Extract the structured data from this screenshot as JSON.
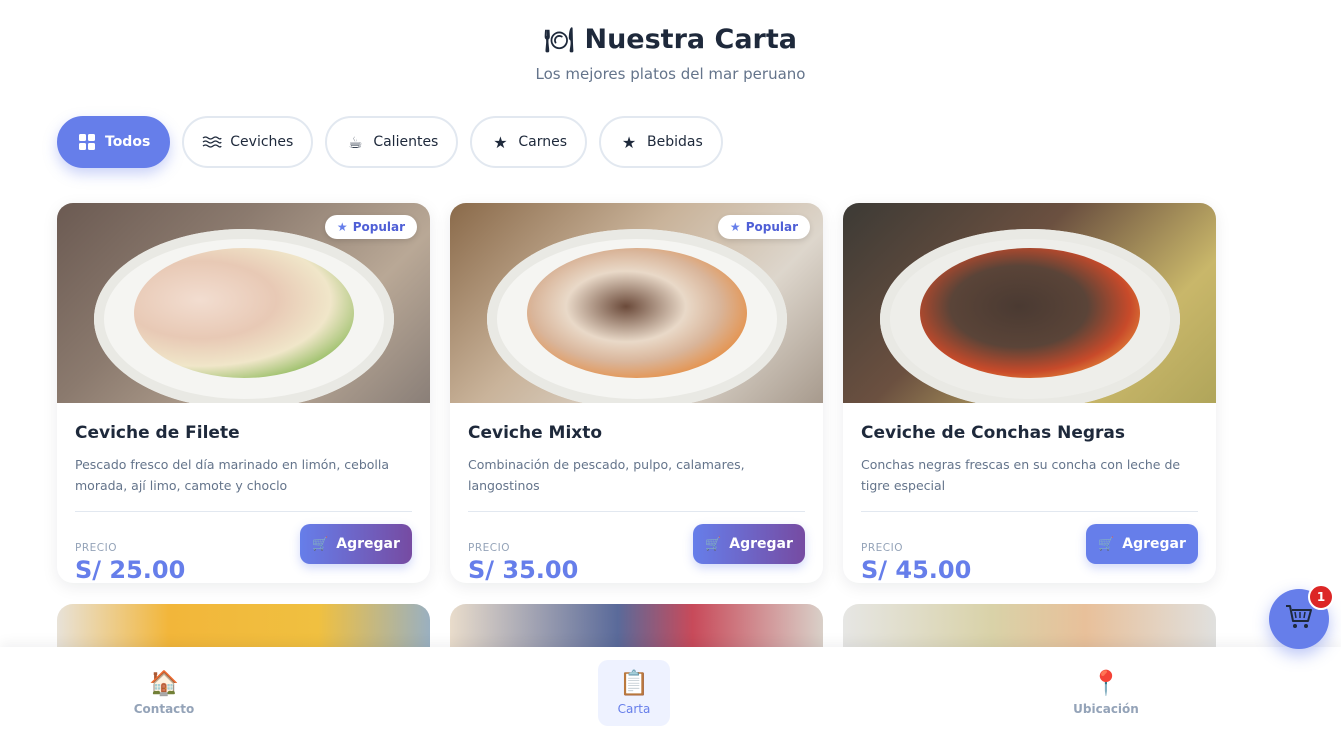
{
  "header": {
    "title": "Nuestra Carta",
    "title_icon": "plate-cutlery-icon",
    "subtitle": "Los mejores platos del mar peruano"
  },
  "filters": [
    {
      "label": "Todos",
      "icon": "grid-icon",
      "active": true
    },
    {
      "label": "Ceviches",
      "icon": "waves-icon",
      "active": false
    },
    {
      "label": "Calientes",
      "icon": "hot-cup-icon",
      "active": false
    },
    {
      "label": "Carnes",
      "icon": "star-icon",
      "active": false
    },
    {
      "label": "Bebidas",
      "icon": "star-icon",
      "active": false
    }
  ],
  "dishes": [
    {
      "name": "Ceviche de Filete",
      "description": "Pescado fresco del día marinado en limón, cebolla morada, ají limo, camote y choclo",
      "price_label": "PRECIO",
      "price": "S/ 25.00",
      "badge": "Popular",
      "button": "Agregar"
    },
    {
      "name": "Ceviche Mixto",
      "description": "Combinación de pescado, pulpo, calamares, langostinos",
      "price_label": "PRECIO",
      "price": "S/ 35.00",
      "badge": "Popular",
      "button": "Agregar"
    },
    {
      "name": "Ceviche de Conchas Negras",
      "description": "Conchas negras frescas en su concha con leche de tigre especial",
      "price_label": "PRECIO",
      "price": "S/ 45.00",
      "badge": "",
      "button": "Agregar"
    }
  ],
  "bottom_nav": [
    {
      "label": "Contacto",
      "icon": "house-icon",
      "active": false
    },
    {
      "label": "Carta",
      "icon": "clipboard-icon",
      "active": true
    },
    {
      "label": "Ubicación",
      "icon": "map-pin-icon",
      "active": false
    }
  ],
  "cart": {
    "count": "1",
    "icon": "shopping-cart-icon"
  },
  "colors": {
    "accent": "#667eea",
    "accent_end": "#764ba2",
    "badge_red": "#dc2626"
  }
}
